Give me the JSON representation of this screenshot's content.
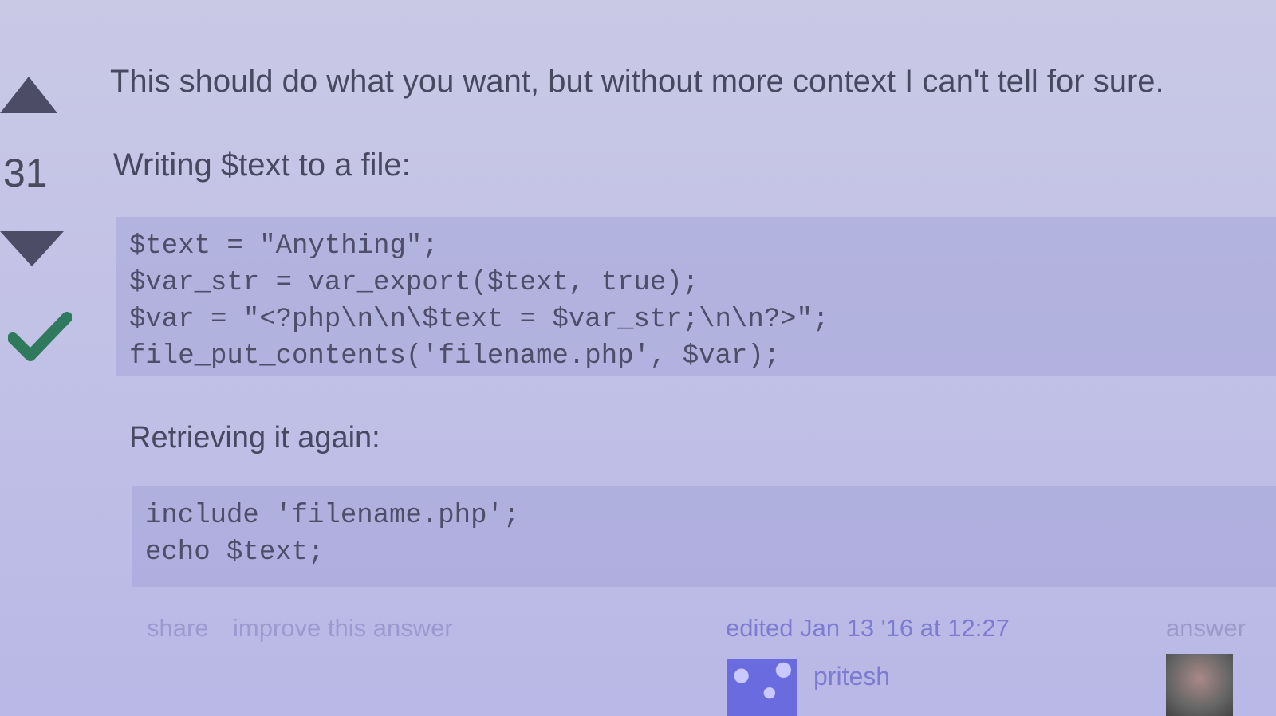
{
  "answer": {
    "vote_count": "31",
    "intro": "This should do what you want, but without more context I can't tell for sure.",
    "write_label": "Writing $text to a file:",
    "code_write": [
      "$text = \"Anything\";",
      "$var_str = var_export($text, true);",
      "$var = \"<?php\\n\\n\\$text = $var_str;\\n\\n?>\";",
      "file_put_contents('filename.php', $var);"
    ],
    "retrieve_label": "Retrieving it again:",
    "code_retrieve": [
      "include 'filename.php';",
      "echo $text;"
    ]
  },
  "footer": {
    "share": "share",
    "improve": "improve this answer",
    "edited": "edited Jan 13 '16 at 12:27",
    "editor_name": "pritesh",
    "answered": "answer"
  },
  "colors": {
    "accepted": "#2f7a5c",
    "vote_arrows": "#4c4c66"
  },
  "icons": {
    "up": "up-arrow-icon",
    "down": "down-arrow-icon",
    "accepted": "checkmark-icon"
  }
}
